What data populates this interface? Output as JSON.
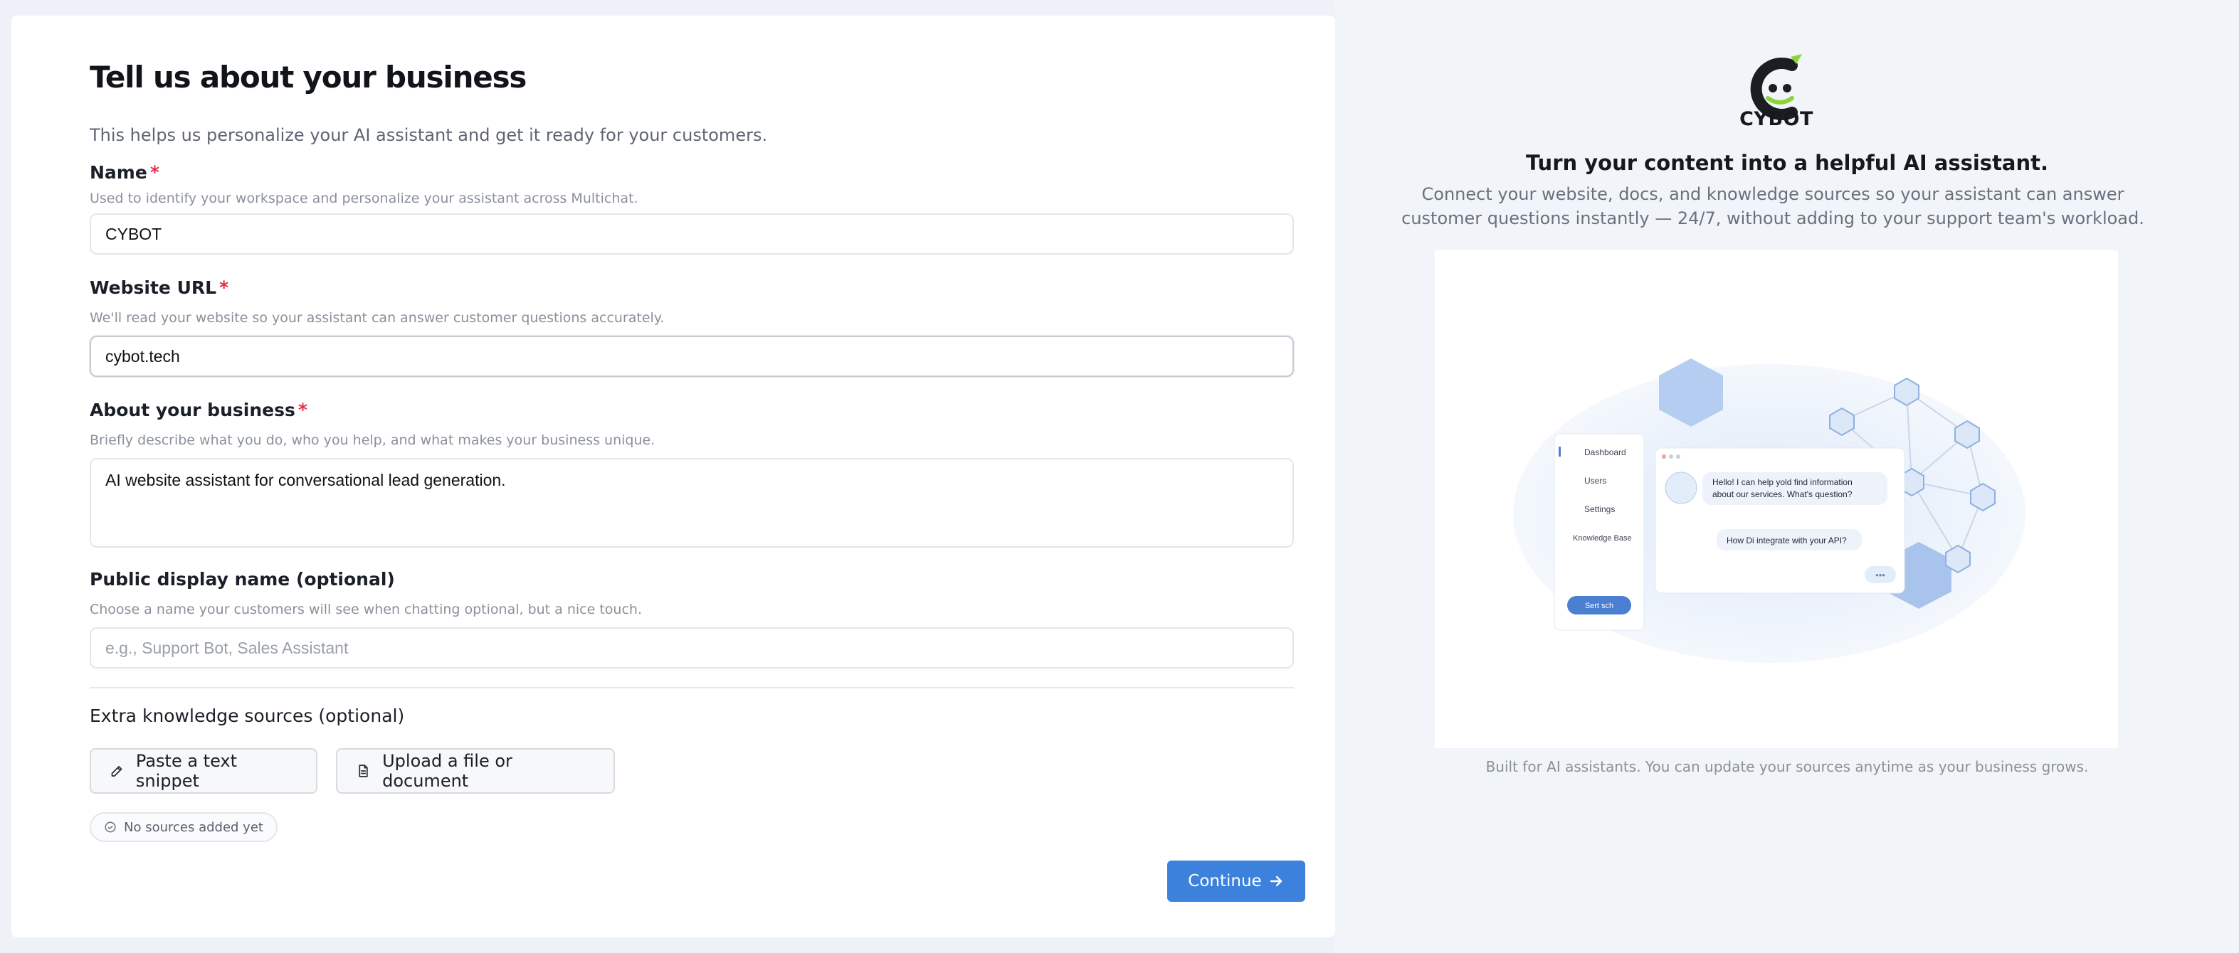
{
  "form": {
    "title": "Tell us about your business",
    "subtitle": "This helps us personalize your AI assistant and get it ready for your customers.",
    "name": {
      "label": "Name",
      "required_mark": "*",
      "help": "Used to identify your workspace and personalize your assistant across Multichat.",
      "value": "CYBOT"
    },
    "website": {
      "label": "Website URL",
      "required_mark": "*",
      "help": "We'll read your website so your assistant can answer customer questions accurately.",
      "value": "cybot.tech"
    },
    "about": {
      "label": "About your business",
      "required_mark": "*",
      "help": "Briefly describe what you do, who you help, and what makes your business unique.",
      "value": "AI website assistant for conversational lead generation."
    },
    "display_name": {
      "label": "Public display name (optional)",
      "help": "Choose a name your customers will see when chatting optional, but a nice touch.",
      "placeholder": "e.g., Support Bot, Sales Assistant",
      "value": ""
    },
    "extra_sources": {
      "label": "Extra knowledge sources (optional)",
      "paste_button": "Paste a text snippet",
      "upload_button": "Upload a file or document",
      "status": "No sources added yet"
    },
    "continue_button": "Continue"
  },
  "aside": {
    "brand": "CYBOT",
    "title": "Turn your content into a helpful AI assistant.",
    "description": "Connect your website, docs, and knowledge sources so your assistant can answer customer questions instantly — 24/7, without adding to your support team's workload.",
    "caption": "Built for AI assistants. You can update your sources anytime as your business grows.",
    "illustration": {
      "sidebar_items": [
        "Dashboard",
        "Users",
        "Settings",
        "Knowledge Base"
      ],
      "sidebar_button": "Sert sch",
      "bot_message": [
        "Hello! I can help yold find information",
        "about our services. What's question?"
      ],
      "user_message": "How Di integrate with your API?",
      "typing": "•••"
    },
    "colors": {
      "accent": "#3c82dc",
      "logo_green": "#8cd43a",
      "required": "#e0314b"
    }
  }
}
